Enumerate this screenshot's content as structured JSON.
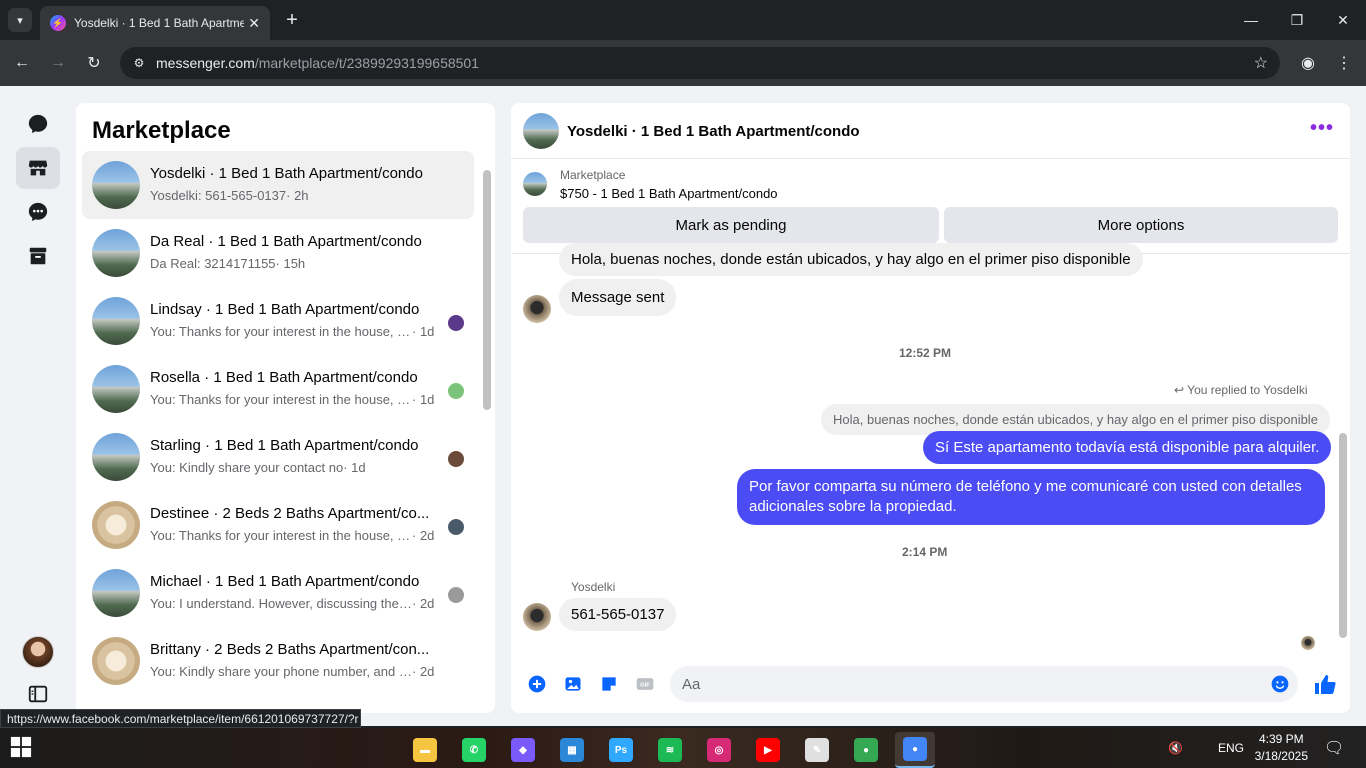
{
  "browser": {
    "tab_title": "Yosdelki · 1 Bed 1 Bath Apartme",
    "url_host": "messenger.com",
    "url_path": "/marketplace/t/23899293199658501",
    "status_url": "https://www.facebook.com/marketplace/item/661201069737727/?r"
  },
  "sidebar": {
    "title": "Marketplace",
    "conversations": [
      {
        "name": "Yosdelki · 1 Bed 1 Bath Apartment/condo",
        "preview": "Yosdelki: 561-565-0137",
        "time": "· 2h",
        "avatar": "apartment",
        "selected": true
      },
      {
        "name": "Da Real · 1 Bed 1 Bath Apartment/condo",
        "preview": "Da Real: 3214171155",
        "time": "· 15h",
        "avatar": "apartment"
      },
      {
        "name": "Lindsay · 1 Bed 1 Bath Apartment/condo",
        "preview": "You: Thanks for your interest in the house, w...",
        "time": " · 1d",
        "avatar": "apartment",
        "seen_color": "#5b3a8c"
      },
      {
        "name": "Rosella · 1 Bed 1 Bath Apartment/condo",
        "preview": "You: Thanks for your interest in the house, w...",
        "time": " · 1d",
        "avatar": "apartment",
        "seen_color": "#7cc47c"
      },
      {
        "name": "Starling · 1 Bed 1 Bath Apartment/condo",
        "preview": "You: Kindly share your contact no",
        "time": " · 1d",
        "avatar": "apartment",
        "seen_color": "#6b4a3a"
      },
      {
        "name": "Destinee · 2 Beds 2 Baths Apartment/co...",
        "preview": "You: Thanks for your interest in the house, w...",
        "time": " · 2d",
        "avatar": "room",
        "seen_color": "#4a5a6a"
      },
      {
        "name": "Michael · 1 Bed 1 Bath Apartment/condo",
        "preview": "You: I understand. However, discussing the d...",
        "time": " · 2d",
        "avatar": "apartment",
        "seen_color": "#9a9a9a"
      },
      {
        "name": "Brittany · 2 Beds 2 Baths Apartment/con...",
        "preview": "You: Kindly share your phone number, and I ...",
        "time": " · 2d",
        "avatar": "room"
      }
    ]
  },
  "chat": {
    "header_title": "Yosdelki · 1 Bed 1 Bath Apartment/condo",
    "listing_category": "Marketplace",
    "listing_title": "$750 - 1 Bed 1 Bath Apartment/condo",
    "mark_pending": "Mark as pending",
    "more_options": "More options",
    "messages": {
      "in_1": "Hola, buenas noches, donde están ubicados, y hay algo en el primer piso disponible",
      "in_2": "Message sent",
      "time_1": "12:52 PM",
      "replied_label": "You replied to Yosdelki",
      "quoted": "Hola, buenas noches, donde están ubicados, y hay algo en el primer piso disponible",
      "out_1": "Sí Este apartamento todavía está disponible para alquiler.",
      "out_2": "Por favor comparta su número de teléfono y me comunicaré con usted con detalles adicionales sobre la propiedad.",
      "time_2": "2:14 PM",
      "sender_name": "Yosdelki",
      "in_3": "561-565-0137"
    },
    "composer_placeholder": "Aa"
  },
  "taskbar": {
    "apps": [
      "file-explorer",
      "whatsapp",
      "copilot",
      "microsoft-store",
      "photoshop",
      "spotify",
      "instagram",
      "youtube",
      "paint",
      "chrome",
      "chrome-profile"
    ],
    "language": "ENG",
    "time": "4:39 PM",
    "date": "3/18/2025"
  },
  "colors": {
    "accent_out_bubble": "#4c4cf5",
    "messenger_blue": "#0866ff",
    "more_purple": "#8a2be2"
  }
}
